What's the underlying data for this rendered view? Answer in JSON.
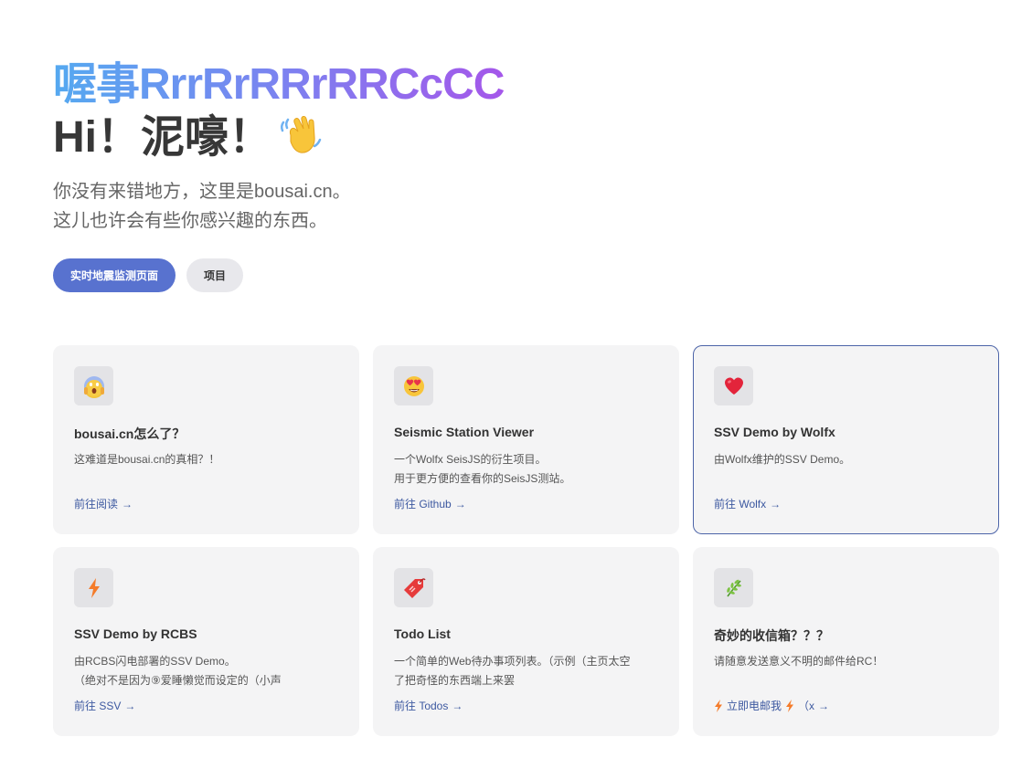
{
  "hero": {
    "title_line1": "喔事RrrRrRRrRRCcCC",
    "title_line2": "Hi！泥嚎！",
    "subtitle_line1": "你没有来错地方，这里是bousai.cn。",
    "subtitle_line2": "这儿也许会有些你感兴趣的东西。"
  },
  "buttons": {
    "primary": "实时地震监测页面",
    "secondary": "项目"
  },
  "cards": [
    {
      "icon": "scream-face-icon",
      "title": "bousai.cn怎么了？",
      "desc": [
        "这难道是bousai.cn的真相？！"
      ],
      "link": "前往阅读"
    },
    {
      "icon": "heart-eyes-face-icon",
      "title": "Seismic Station Viewer",
      "desc": [
        "一个Wolfx SeisJS的衍生项目。",
        "用于更方便的查看你的SeisJS测站。"
      ],
      "link": "前往 Github"
    },
    {
      "icon": "heart-icon",
      "title": "SSV Demo by Wolfx",
      "desc": [
        "由Wolfx维护的SSV Demo。"
      ],
      "link": "前往 Wolfx"
    },
    {
      "icon": "lightning-icon",
      "title": "SSV Demo by RCBS",
      "desc": [
        "由RCBS闪电部署的SSV Demo。",
        "（绝对不是因为⑨爱睡懒觉而设定的（小声"
      ],
      "link": "前往 SSV"
    },
    {
      "icon": "tag-icon",
      "title": "Todo List",
      "desc": [
        "一个简单的Web待办事项列表。（示例（主页太空",
        "了把奇怪的东西端上来罢"
      ],
      "link": "前往 Todos"
    },
    {
      "icon": "herb-icon",
      "title": "奇妙的收信箱？？？",
      "desc": [
        "请随意发送意义不明的邮件给RC！"
      ],
      "link_parts": [
        "立即电邮我",
        "（x"
      ]
    }
  ],
  "colors": {
    "primary_button": "#5872cf",
    "link": "#3c58a0",
    "card_bg": "#f4f4f5",
    "active_border": "#4c64a8",
    "gradient": [
      "#55a9f0",
      "#c33ee3"
    ]
  }
}
